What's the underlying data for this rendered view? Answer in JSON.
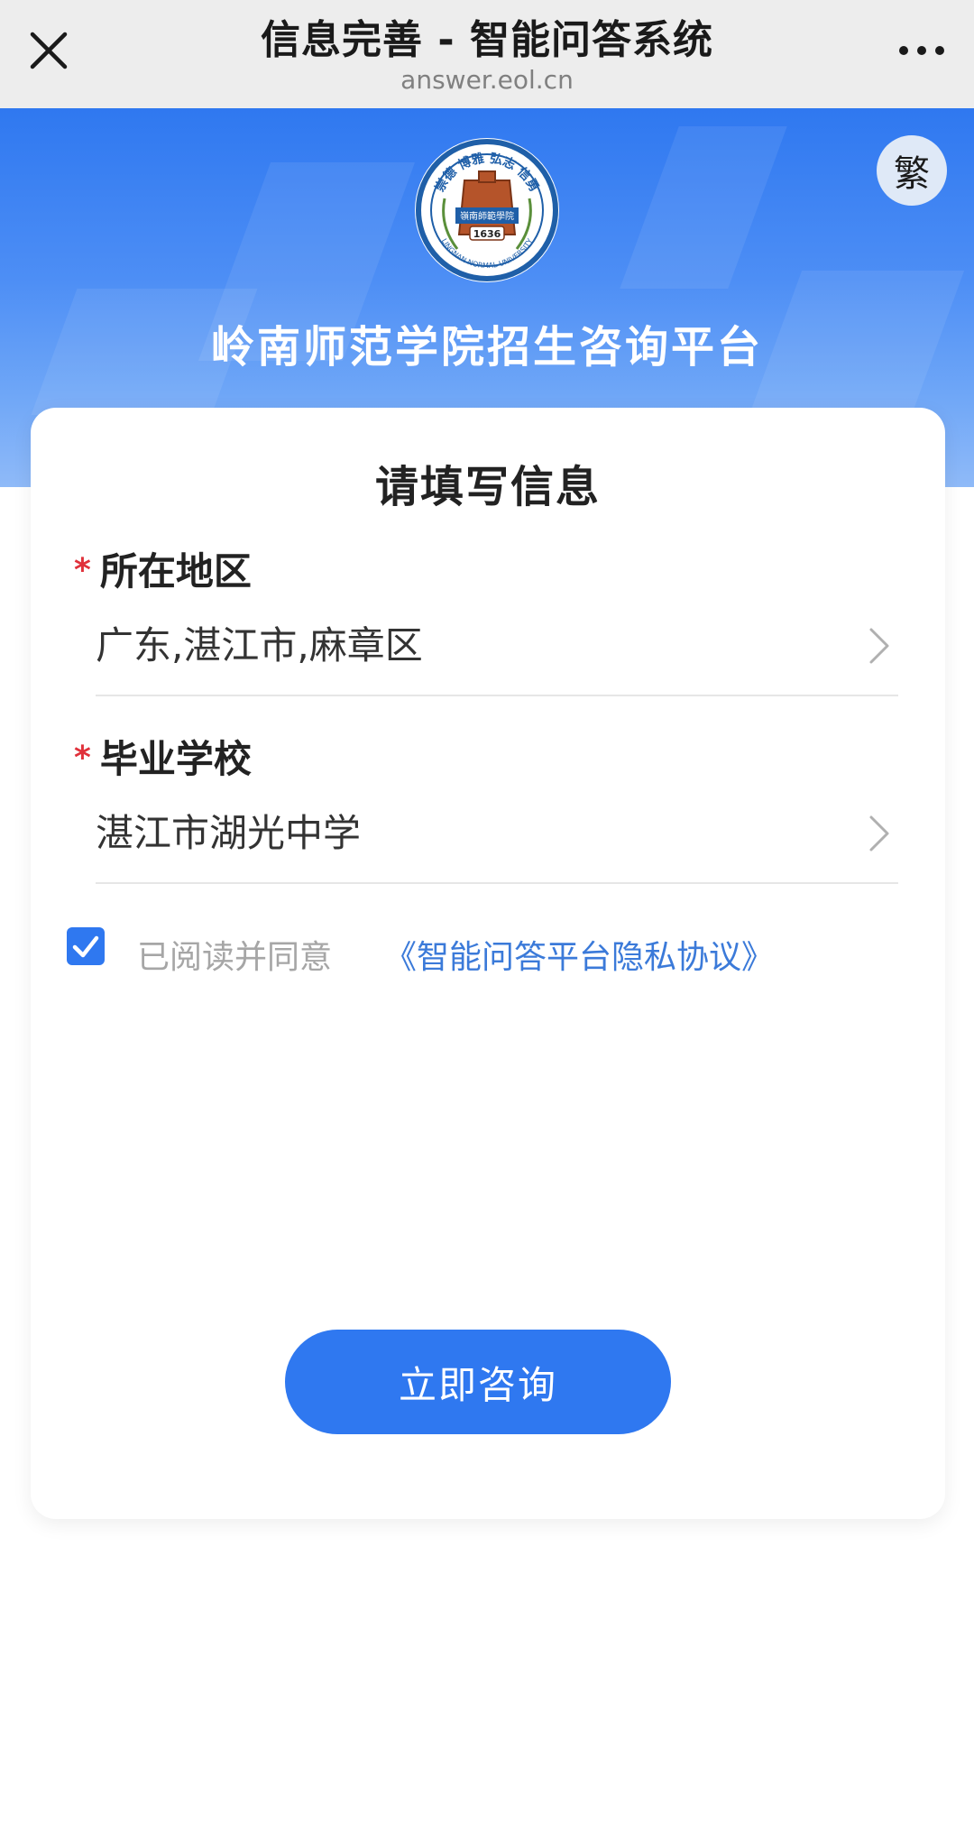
{
  "topbar": {
    "title": "信息完善 - 智能问答系统",
    "url": "answer.eol.cn",
    "close_icon": "close-icon",
    "more_icon": "more-horizontal-icon"
  },
  "banner": {
    "lang_toggle": "繁",
    "logo": {
      "motto": "崇德 博雅 弘志 信勇",
      "school_name": "嶺南師範學院",
      "year": "1636",
      "english": "LINGNAN NORMAL UNIVERSITY"
    },
    "platform_title": "岭南师范学院招生咨询平台"
  },
  "form": {
    "title": "请填写信息",
    "region": {
      "required_mark": "*",
      "label": "所在地区",
      "value": "广东,湛江市,麻章区"
    },
    "school": {
      "required_mark": "*",
      "label": "毕业学校",
      "value": "湛江市湖光中学"
    },
    "agreement": {
      "checked": true,
      "text": "已阅读并同意",
      "link": "《智能问答平台隐私协议》"
    },
    "submit_label": "立即咨询"
  },
  "colors": {
    "primary": "#2f78f0",
    "link": "#3b7ad9",
    "required": "#e0313b"
  }
}
